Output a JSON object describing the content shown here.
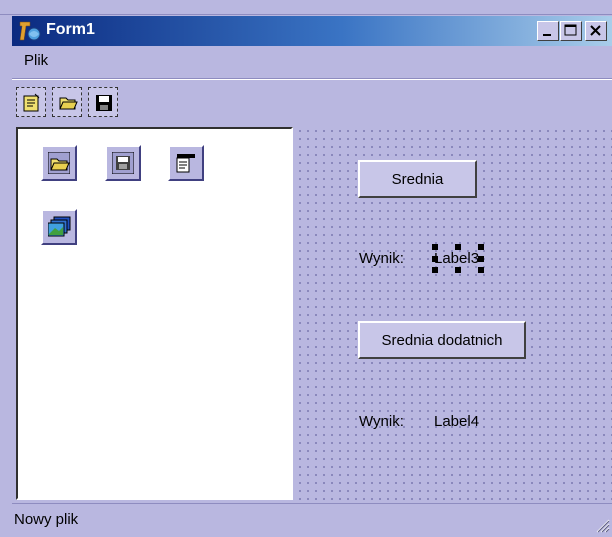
{
  "window": {
    "title": "Form1",
    "minimize_glyph": "_",
    "maximize_glyph": "□",
    "close_glyph": "×"
  },
  "menu": {
    "items": [
      {
        "label": "Plik"
      }
    ]
  },
  "toolbar": {
    "buttons": [
      {
        "icon": "new-file-icon"
      },
      {
        "icon": "open-folder-icon"
      },
      {
        "icon": "save-disk-icon"
      }
    ]
  },
  "components": [
    {
      "icon": "open-dialog-icon"
    },
    {
      "icon": "save-dialog-icon"
    },
    {
      "icon": "main-menu-icon"
    },
    {
      "icon": "image-list-icon"
    }
  ],
  "form": {
    "button1_label": "Srednia",
    "result_label_1": "Wynik:",
    "label3_text": "Label3",
    "button2_label": "Srednia dodatnich",
    "result_label_2": "Wynik:",
    "label4_text": "Label4"
  },
  "status": {
    "text": "Nowy plik"
  },
  "colors": {
    "title_start": "#0b2a80",
    "title_end": "#a9cdea",
    "form_bg": "#b9b7e0"
  }
}
